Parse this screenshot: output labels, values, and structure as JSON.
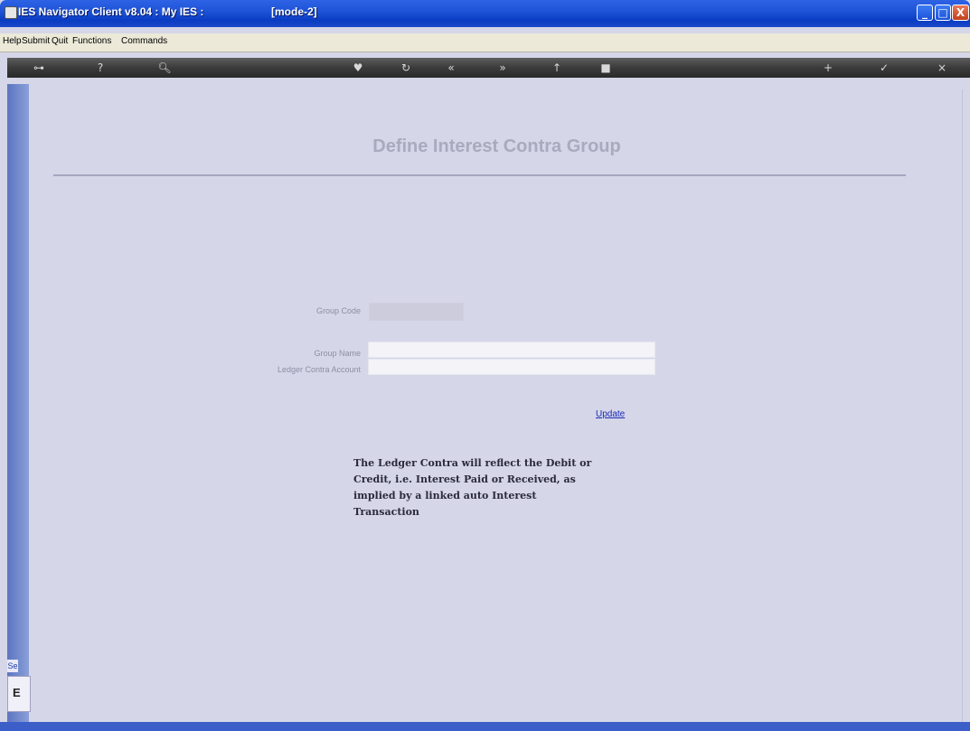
{
  "window": {
    "title": "IES Navigator Client v8.04 : My IES :",
    "mode": "[mode-2]",
    "controls": {
      "minimize": "_",
      "maximize": "□",
      "close": "X"
    }
  },
  "menu": {
    "items": [
      "Help",
      "Submit",
      "Quit",
      "Functions",
      "Commands"
    ]
  },
  "toolbar": {
    "icons": [
      "key-icon",
      "help-icon",
      "search-icon",
      "heart-icon",
      "refresh-icon",
      "back-icon",
      "forward-icon",
      "up-icon",
      "stop-icon",
      "add-icon",
      "check-icon",
      "close-icon"
    ]
  },
  "form": {
    "title": "Define Interest Contra Group",
    "group_code_label": "Group Code",
    "group_code_value": "",
    "group_name_label": "Group Name",
    "group_name_value": "",
    "ledger_label": "Ledger Contra Account",
    "ledger_value": "",
    "update_label": "Update",
    "note": "The Ledger Contra will reflect the Debit or Credit, i.e. Interest Paid or Received, as implied by a linked auto Interest Transaction"
  },
  "side": {
    "tab_label": "Se",
    "box_letter": "E"
  },
  "colors": {
    "titlebar": "#1f54d8",
    "content_bg": "#d5d6e8",
    "link": "#1a2bb8"
  }
}
